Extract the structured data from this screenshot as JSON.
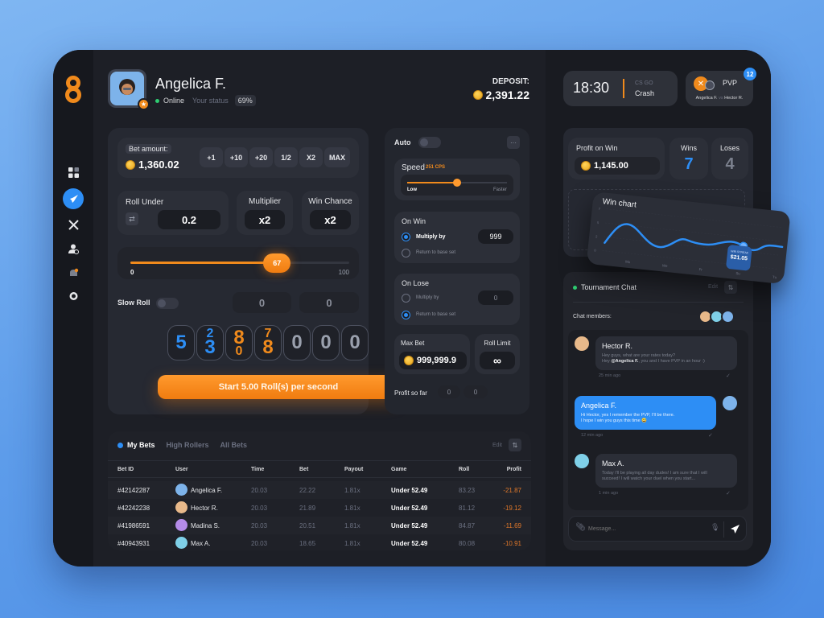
{
  "user": {
    "name": "Angelica F.",
    "status": "Online",
    "status_hint": "Your status",
    "level_pct": "69%"
  },
  "deposit": {
    "label": "DEPOSIT:",
    "value": "2,391.22"
  },
  "timer": {
    "time": "18:30",
    "game_top": "CS GO",
    "game_bottom": "Crash"
  },
  "pvp": {
    "label": "PVP",
    "player1": "Angelica F.",
    "vs": "vs",
    "player2": "Hector R.",
    "badge": "12"
  },
  "nav": [
    "dashboard-icon",
    "rocket-icon",
    "swords-icon",
    "user-check-icon",
    "bell-icon",
    "badge-icon"
  ],
  "bet": {
    "label": "Bet amount:",
    "value": "1,360.02",
    "chips": [
      "+1",
      "+10",
      "+20",
      "1/2",
      "X2",
      "MAX"
    ]
  },
  "roll_under": {
    "label": "Roll Under",
    "value": "0.2"
  },
  "multiplier": {
    "label": "Multiplier",
    "value": "x2"
  },
  "win_chance": {
    "label": "Win Chance",
    "value": "x2"
  },
  "slider": {
    "value": "67",
    "min": "0",
    "max": "100",
    "fraction": 0.67
  },
  "slow_roll": {
    "label": "Slow Roll",
    "field1": "0",
    "field2": "0"
  },
  "reels": [
    {
      "top": "",
      "main": "5",
      "bottom": "",
      "color": "#2d8ef5"
    },
    {
      "top": "2",
      "main": "3",
      "bottom": "",
      "color": "#2d8ef5"
    },
    {
      "top": "",
      "main": "8",
      "bottom": "0",
      "color": "#f08a1c"
    },
    {
      "top": "7",
      "main": "8",
      "bottom": "",
      "color": "#f08a1c"
    },
    {
      "top": "",
      "main": "0",
      "bottom": "",
      "color": "#9aa0ad"
    },
    {
      "top": "",
      "main": "0",
      "bottom": "",
      "color": "#9aa0ad"
    },
    {
      "top": "",
      "main": "0",
      "bottom": "",
      "color": "#9aa0ad"
    }
  ],
  "start_button": "Start 5.00 Roll(s) per second",
  "auto": {
    "label": "Auto",
    "speed_label": "Speed",
    "speed_value": "251 CPS",
    "speed_fraction": 0.5,
    "speed_low": "Low",
    "speed_high": "Faster",
    "on_win": {
      "title": "On Win",
      "opt1": "Multiply by",
      "opt2": "Return to base set",
      "value": "999"
    },
    "on_lose": {
      "title": "On Lose",
      "opt1": "Multiply by",
      "opt2": "Return to base set",
      "value": "0"
    },
    "max_bet": {
      "label": "Max Bet",
      "value": "999,999.9"
    },
    "roll_limit": {
      "label": "Roll Limit",
      "value": "∞"
    },
    "profit": {
      "label": "Profit so far",
      "v1": "0",
      "v2": "0"
    }
  },
  "bets": {
    "tabs": [
      "My Bets",
      "High Rollers",
      "All Bets"
    ],
    "edit": "Edit",
    "columns": [
      "Bet ID",
      "User",
      "Time",
      "Bet",
      "Payout",
      "Game",
      "Roll",
      "Profit"
    ],
    "rows": [
      {
        "id": "#42142287",
        "user": "Angelica F.",
        "time": "20.03",
        "bet": "22.22",
        "payout": "1.81x",
        "game": "Under 52.49",
        "roll": "83.23",
        "profit": "-21.87",
        "avatar": "#7db3ea"
      },
      {
        "id": "#42242238",
        "user": "Hector R.",
        "time": "20.03",
        "bet": "21.89",
        "payout": "1.81x",
        "game": "Under 52.49",
        "roll": "81.12",
        "profit": "-19.12",
        "avatar": "#e8b98a"
      },
      {
        "id": "#41986591",
        "user": "Madina S.",
        "time": "20.03",
        "bet": "20.51",
        "payout": "1.81x",
        "game": "Under 52.49",
        "roll": "84.87",
        "profit": "-11.69",
        "avatar": "#b48be8"
      },
      {
        "id": "#40943931",
        "user": "Max A.",
        "time": "20.03",
        "bet": "18.65",
        "payout": "1.81x",
        "game": "Under 52.49",
        "roll": "80.08",
        "profit": "-10.91",
        "avatar": "#7fd0e8"
      }
    ]
  },
  "stats": {
    "profit_label": "Profit on Win",
    "profit_value": "1,145.00",
    "wins_label": "Wins",
    "wins_value": "7",
    "loses_label": "Loses",
    "loses_value": "4"
  },
  "win_chart": {
    "title": "Win chart",
    "y_ticks": [
      "0",
      "2",
      "5",
      "7"
    ],
    "x_ticks": [
      "Mo",
      "We",
      "Fr",
      "Su",
      "Tu"
    ],
    "tooltip_label": "WIN STREAK",
    "tooltip_value": "$21.05"
  },
  "chat": {
    "title": "Tournament Chat",
    "edit": "Edit",
    "members_label": "Chat members:",
    "messages": [
      {
        "author": "Hector R.",
        "line1": "Hey guys, what are your rates today?",
        "line2_pre": "Hey ",
        "mention": "@Angelica F.",
        "line2_post": ", you and I have PVP in an hour :)",
        "time": "25 min ago"
      },
      {
        "author": "Angelica F.",
        "line1": "Hi Hector, yes I remember the PVP, I'll be there.",
        "line2": "I hope I win you guys this time 😅",
        "time": "12 min ago"
      },
      {
        "author": "Max A.",
        "line1": "Today I'll be playing all day dudes! I am sure that I will",
        "line2": "succeed! I will watch your duel when you start...",
        "time": "1 min ago"
      }
    ],
    "input_placeholder": "Message..."
  },
  "colors": {
    "accent_orange": "#f08a1c",
    "accent_blue": "#2d8ef5",
    "online_green": "#2ecc71",
    "loss_orange": "#e0782a"
  }
}
